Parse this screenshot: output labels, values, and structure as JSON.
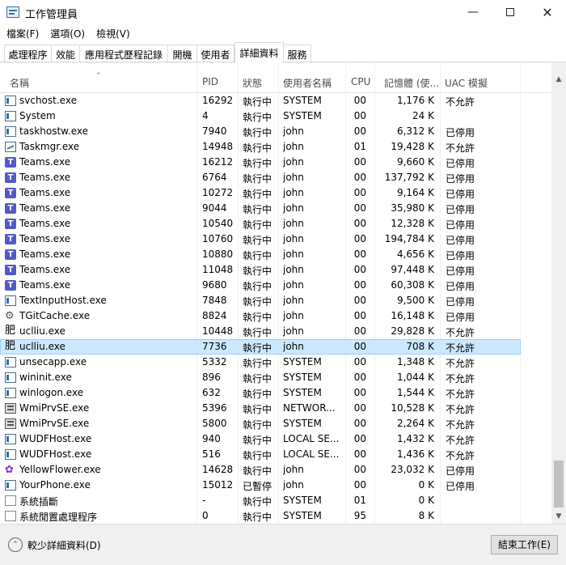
{
  "window": {
    "title": "工作管理員",
    "minimize_icon": "minimize-icon",
    "maximize_icon": "maximize-icon",
    "close_icon": "close-icon"
  },
  "menu": [
    "檔案(F)",
    "選項(O)",
    "檢視(V)"
  ],
  "tabs": [
    {
      "label": "處理程序",
      "active": false
    },
    {
      "label": "效能",
      "active": false
    },
    {
      "label": "應用程式歷程記錄",
      "active": false
    },
    {
      "label": "開機",
      "active": false
    },
    {
      "label": "使用者",
      "active": false
    },
    {
      "label": "詳細資料",
      "active": true
    },
    {
      "label": "服務",
      "active": false
    }
  ],
  "columns": [
    "名稱",
    "PID",
    "狀態",
    "使用者名稱",
    "CPU",
    "記憶體 (使...",
    "UAC 模擬"
  ],
  "rows": [
    {
      "icon": "window-icon",
      "name": "svchost.exe",
      "pid": "16292",
      "status": "執行中",
      "user": "SYSTEM",
      "cpu": "00",
      "mem": "1,176 K",
      "uac": "不允許"
    },
    {
      "icon": "window-icon",
      "name": "System",
      "pid": "4",
      "status": "執行中",
      "user": "SYSTEM",
      "cpu": "00",
      "mem": "24 K",
      "uac": ""
    },
    {
      "icon": "window-icon",
      "name": "taskhostw.exe",
      "pid": "7940",
      "status": "執行中",
      "user": "john",
      "cpu": "00",
      "mem": "6,312 K",
      "uac": "已停用"
    },
    {
      "icon": "taskmgr-icon",
      "name": "Taskmgr.exe",
      "pid": "14948",
      "status": "執行中",
      "user": "john",
      "cpu": "01",
      "mem": "19,428 K",
      "uac": "不允許"
    },
    {
      "icon": "teams-icon",
      "name": "Teams.exe",
      "pid": "16212",
      "status": "執行中",
      "user": "john",
      "cpu": "00",
      "mem": "9,660 K",
      "uac": "已停用"
    },
    {
      "icon": "teams-icon",
      "name": "Teams.exe",
      "pid": "6764",
      "status": "執行中",
      "user": "john",
      "cpu": "00",
      "mem": "137,792 K",
      "uac": "已停用"
    },
    {
      "icon": "teams-icon",
      "name": "Teams.exe",
      "pid": "10272",
      "status": "執行中",
      "user": "john",
      "cpu": "00",
      "mem": "9,164 K",
      "uac": "已停用"
    },
    {
      "icon": "teams-icon",
      "name": "Teams.exe",
      "pid": "9044",
      "status": "執行中",
      "user": "john",
      "cpu": "00",
      "mem": "35,980 K",
      "uac": "已停用"
    },
    {
      "icon": "teams-icon",
      "name": "Teams.exe",
      "pid": "10540",
      "status": "執行中",
      "user": "john",
      "cpu": "00",
      "mem": "12,328 K",
      "uac": "已停用"
    },
    {
      "icon": "teams-icon",
      "name": "Teams.exe",
      "pid": "10760",
      "status": "執行中",
      "user": "john",
      "cpu": "00",
      "mem": "194,784 K",
      "uac": "已停用"
    },
    {
      "icon": "teams-icon",
      "name": "Teams.exe",
      "pid": "10880",
      "status": "執行中",
      "user": "john",
      "cpu": "00",
      "mem": "4,656 K",
      "uac": "已停用"
    },
    {
      "icon": "teams-icon",
      "name": "Teams.exe",
      "pid": "11048",
      "status": "執行中",
      "user": "john",
      "cpu": "00",
      "mem": "97,448 K",
      "uac": "已停用"
    },
    {
      "icon": "teams-icon",
      "name": "Teams.exe",
      "pid": "9680",
      "status": "執行中",
      "user": "john",
      "cpu": "00",
      "mem": "60,308 K",
      "uac": "已停用"
    },
    {
      "icon": "window-icon",
      "name": "TextInputHost.exe",
      "pid": "7848",
      "status": "執行中",
      "user": "john",
      "cpu": "00",
      "mem": "9,500 K",
      "uac": "已停用"
    },
    {
      "icon": "gear-icon",
      "name": "TGitCache.exe",
      "pid": "8824",
      "status": "執行中",
      "user": "john",
      "cpu": "00",
      "mem": "16,148 K",
      "uac": "已停用"
    },
    {
      "icon": "uclliu-icon",
      "name": "uclliu.exe",
      "pid": "10448",
      "status": "執行中",
      "user": "john",
      "cpu": "00",
      "mem": "29,828 K",
      "uac": "不允許"
    },
    {
      "icon": "uclliu-icon",
      "name": "uclliu.exe",
      "pid": "7736",
      "status": "執行中",
      "user": "john",
      "cpu": "00",
      "mem": "708 K",
      "uac": "不允許",
      "selected": true
    },
    {
      "icon": "window-icon",
      "name": "unsecapp.exe",
      "pid": "5332",
      "status": "執行中",
      "user": "SYSTEM",
      "cpu": "00",
      "mem": "1,348 K",
      "uac": "不允許"
    },
    {
      "icon": "window-icon",
      "name": "wininit.exe",
      "pid": "896",
      "status": "執行中",
      "user": "SYSTEM",
      "cpu": "00",
      "mem": "1,044 K",
      "uac": "不允許"
    },
    {
      "icon": "window-icon",
      "name": "winlogon.exe",
      "pid": "632",
      "status": "執行中",
      "user": "SYSTEM",
      "cpu": "00",
      "mem": "1,544 K",
      "uac": "不允許"
    },
    {
      "icon": "server-icon",
      "name": "WmiPrvSE.exe",
      "pid": "5396",
      "status": "執行中",
      "user": "NETWOR...",
      "cpu": "00",
      "mem": "10,528 K",
      "uac": "不允許"
    },
    {
      "icon": "server-icon",
      "name": "WmiPrvSE.exe",
      "pid": "5800",
      "status": "執行中",
      "user": "SYSTEM",
      "cpu": "00",
      "mem": "2,264 K",
      "uac": "不允許"
    },
    {
      "icon": "window-icon",
      "name": "WUDFHost.exe",
      "pid": "940",
      "status": "執行中",
      "user": "LOCAL SE...",
      "cpu": "00",
      "mem": "1,432 K",
      "uac": "不允許"
    },
    {
      "icon": "window-icon",
      "name": "WUDFHost.exe",
      "pid": "516",
      "status": "執行中",
      "user": "LOCAL SE...",
      "cpu": "00",
      "mem": "1,436 K",
      "uac": "不允許"
    },
    {
      "icon": "flower-icon",
      "name": "YellowFlower.exe",
      "pid": "14628",
      "status": "執行中",
      "user": "john",
      "cpu": "00",
      "mem": "23,032 K",
      "uac": "已停用"
    },
    {
      "icon": "window-icon",
      "name": "YourPhone.exe",
      "pid": "15012",
      "status": "已暫停",
      "user": "john",
      "cpu": "00",
      "mem": "0 K",
      "uac": "已停用"
    },
    {
      "icon": "blank-icon",
      "name": "系統插斷",
      "pid": "-",
      "status": "執行中",
      "user": "SYSTEM",
      "cpu": "01",
      "mem": "0 K",
      "uac": ""
    },
    {
      "icon": "blank-icon",
      "name": "系統閒置處理程序",
      "pid": "0",
      "status": "執行中",
      "user": "SYSTEM",
      "cpu": "95",
      "mem": "8 K",
      "uac": ""
    }
  ],
  "footer": {
    "fewer_details": "較少詳細資料(D)",
    "end_task": "結束工作(E)"
  },
  "colors": {
    "selected_bg": "#cce8ff",
    "selected_border": "#99d1ff",
    "teams": "#5059c9"
  }
}
